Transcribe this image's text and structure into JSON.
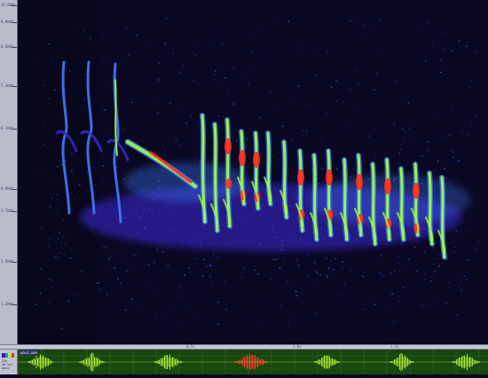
{
  "ruler": {
    "labels": [
      "11.0kHz",
      "9.8kHz",
      "8.5kHz",
      "7.3kHz",
      "6.1kHz",
      "4.9kHz",
      "3.7kHz",
      "2.5kHz",
      "1.2kHz"
    ]
  },
  "timeline": {
    "labels": [
      "0.5s",
      "1.0s",
      "1.5s"
    ]
  },
  "waveform": {
    "file_label": "wav1.wav",
    "info_lines": [
      "22k",
      "16 bit",
      "mono"
    ]
  },
  "colors": {
    "background": "#0b0824",
    "low": "#3a2bd6",
    "mid": "#3f7cff",
    "high": "#9cff3a",
    "peak": "#ff2a1a",
    "waveform": "#b8f23a",
    "waveform_selected": "#ff3a2a"
  }
}
